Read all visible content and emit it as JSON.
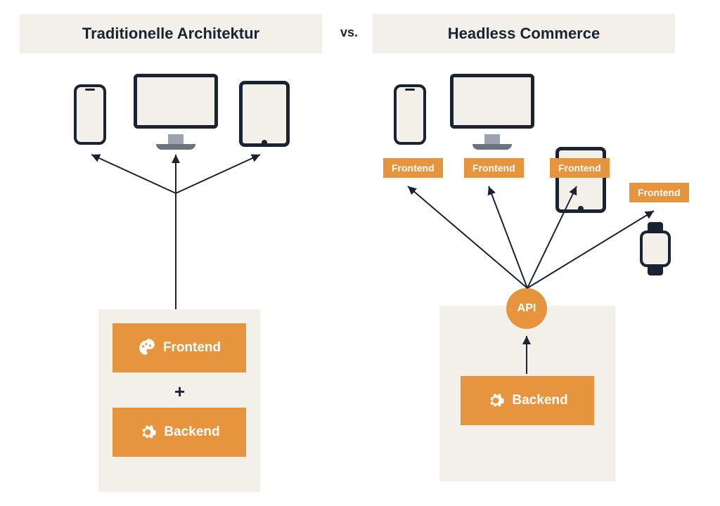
{
  "titles": {
    "left": "Traditionelle Architektur",
    "right": "Headless Commerce",
    "vs": "vs."
  },
  "labels": {
    "frontend": "Frontend",
    "backend": "Backend",
    "api": "API",
    "plus": "+"
  },
  "colors": {
    "accent": "#e6953e",
    "panel": "#f3efe9",
    "ink": "#1a2332"
  },
  "left": {
    "devices": [
      "phone",
      "monitor",
      "tablet"
    ],
    "stack": [
      "frontend",
      "backend"
    ]
  },
  "right": {
    "devices": [
      "phone",
      "monitor",
      "tablet",
      "watch"
    ],
    "frontend_badges": 4,
    "hub": "api",
    "stack": [
      "backend"
    ]
  }
}
